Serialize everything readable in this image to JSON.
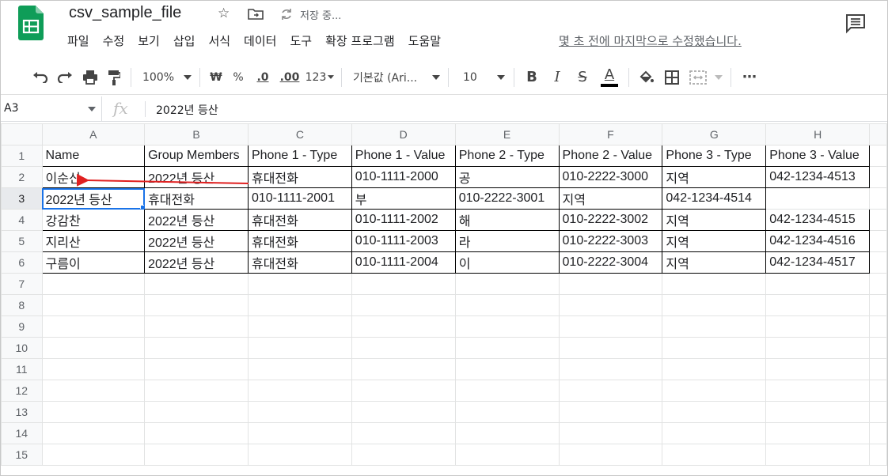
{
  "doc": {
    "title": "csv_sample_file",
    "save_status": "저장 중...",
    "last_edit": "몇 초 전에 마지막으로 수정했습니다."
  },
  "menu": [
    "파일",
    "수정",
    "보기",
    "삽입",
    "서식",
    "데이터",
    "도구",
    "확장 프로그램",
    "도움말"
  ],
  "toolbar": {
    "zoom": "100%",
    "currency": "₩",
    "percent": "%",
    "dec_decrease": ".0",
    "dec_increase": ".00",
    "more_formats": "123",
    "font": "기본값 (Ari...",
    "font_size": "10",
    "bold": "B",
    "italic": "I",
    "strike": "S",
    "text_color": "A",
    "more": "⋯"
  },
  "formula_bar": {
    "cell_ref": "A3",
    "fx": "fx",
    "value": "2022년 등산"
  },
  "columns": [
    "A",
    "B",
    "C",
    "D",
    "E",
    "F",
    "G",
    "H"
  ],
  "rows": [
    {
      "num": "1",
      "cells": [
        "Name",
        "Group Members",
        "Phone 1 - Type",
        "Phone 1 - Value",
        "Phone 2 - Type",
        "Phone 2 - Value",
        "Phone 3 - Type",
        "Phone 3 - Value"
      ]
    },
    {
      "num": "2",
      "cells": [
        "이순신",
        "2022년 등산",
        "휴대전화",
        "010-1111-2000",
        "공",
        "010-2222-3000",
        "지역",
        "042-1234-4513"
      ]
    },
    {
      "num": "3",
      "cells": [
        "2022년 등산",
        "휴대전화",
        "010-1111-2001",
        "부",
        "010-2222-3001",
        "지역",
        "042-1234-4514",
        ""
      ]
    },
    {
      "num": "4",
      "cells": [
        "강감찬",
        "2022년 등산",
        "휴대전화",
        "010-1111-2002",
        "해",
        "010-2222-3002",
        "지역",
        "042-1234-4515"
      ]
    },
    {
      "num": "5",
      "cells": [
        "지리산",
        "2022년 등산",
        "휴대전화",
        "010-1111-2003",
        "라",
        "010-2222-3003",
        "지역",
        "042-1234-4516"
      ]
    },
    {
      "num": "6",
      "cells": [
        "구름이",
        "2022년 등산",
        "휴대전화",
        "010-1111-2004",
        "이",
        "010-2222-3004",
        "지역",
        "042-1234-4517"
      ]
    },
    {
      "num": "7",
      "cells": [
        "",
        "",
        "",
        "",
        "",
        "",
        "",
        ""
      ]
    },
    {
      "num": "8",
      "cells": [
        "",
        "",
        "",
        "",
        "",
        "",
        "",
        ""
      ]
    },
    {
      "num": "9",
      "cells": [
        "",
        "",
        "",
        "",
        "",
        "",
        "",
        ""
      ]
    },
    {
      "num": "10",
      "cells": [
        "",
        "",
        "",
        "",
        "",
        "",
        "",
        ""
      ]
    },
    {
      "num": "11",
      "cells": [
        "",
        "",
        "",
        "",
        "",
        "",
        "",
        ""
      ]
    },
    {
      "num": "12",
      "cells": [
        "",
        "",
        "",
        "",
        "",
        "",
        "",
        ""
      ]
    },
    {
      "num": "13",
      "cells": [
        "",
        "",
        "",
        "",
        "",
        "",
        "",
        ""
      ]
    },
    {
      "num": "14",
      "cells": [
        "",
        "",
        "",
        "",
        "",
        "",
        "",
        ""
      ]
    },
    {
      "num": "15",
      "cells": [
        "",
        "",
        "",
        "",
        "",
        "",
        "",
        ""
      ]
    }
  ],
  "colors": {
    "accent": "#1a73e8",
    "annotation_arrow": "#e02020",
    "sheets_green": "#0f9d58"
  }
}
